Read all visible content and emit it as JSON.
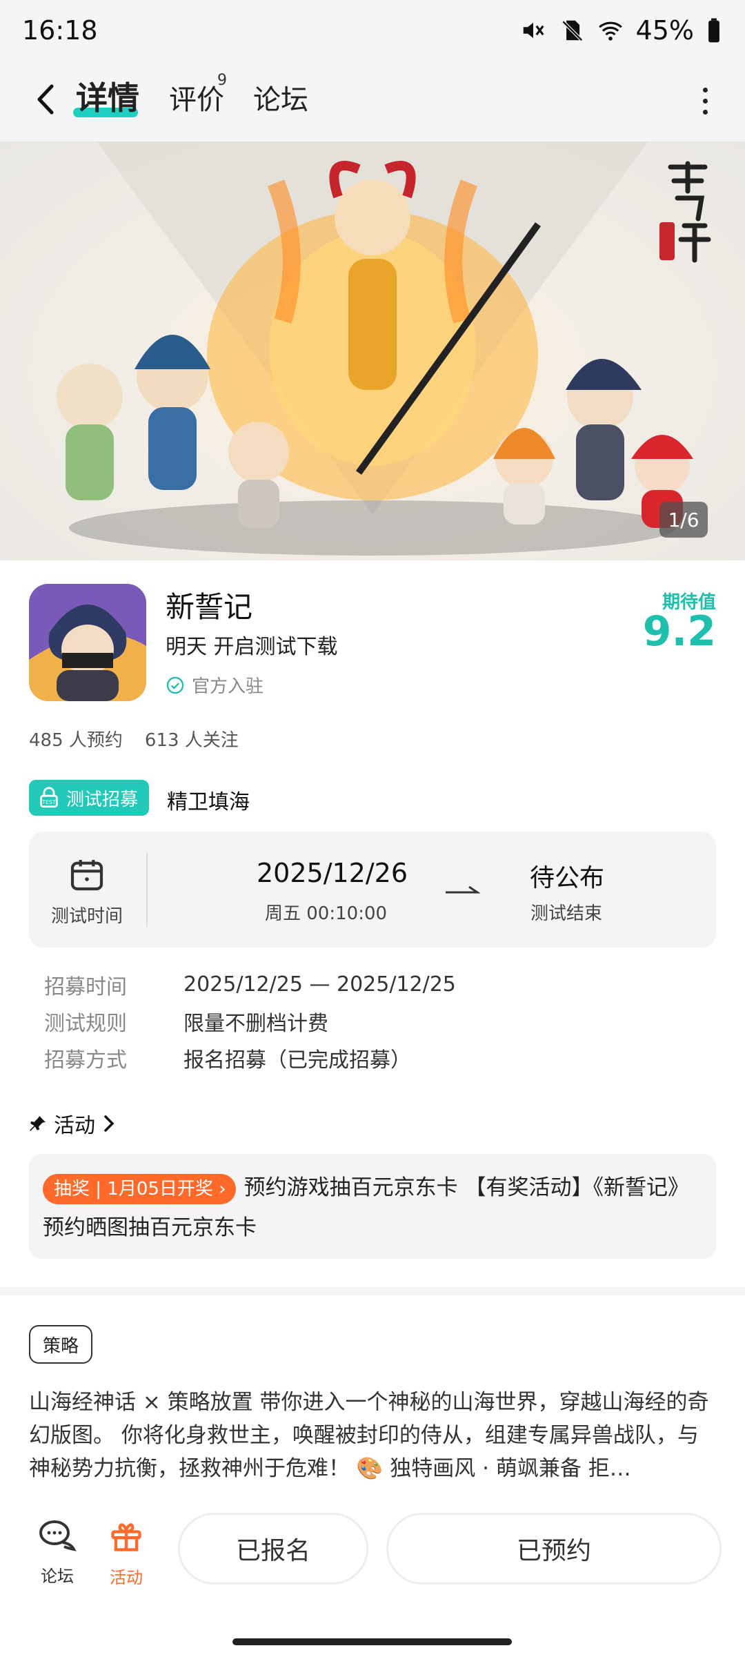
{
  "status_bar": {
    "time": "16:18",
    "battery": "45%"
  },
  "nav": {
    "tabs": [
      {
        "label": "详情"
      },
      {
        "label": "评价"
      },
      {
        "label": "论坛"
      }
    ],
    "review_count": "9"
  },
  "banner": {
    "counter": "1/6",
    "logo_text": "新誓记"
  },
  "game": {
    "title": "新誓记",
    "subtitle": "明天 开启测试下载",
    "official": "官方入驻",
    "expect_label": "期待值",
    "expect_value": "9.2",
    "stats": {
      "reservations": "485 人预约",
      "followers": "613 人关注"
    }
  },
  "recruit": {
    "badge": "测试招募",
    "name": "精卫填海"
  },
  "test_card": {
    "time_label": "测试时间",
    "start_date": "2025/12/26",
    "start_sub": "周五  00:10:00",
    "end_value": "待公布",
    "end_sub": "测试结束"
  },
  "info": [
    {
      "key": "招募时间",
      "value": "2025/12/25 — 2025/12/25"
    },
    {
      "key": "测试规则",
      "value": "限量不删档计费"
    },
    {
      "key": "招募方式",
      "value": "报名招募（已完成招募）"
    }
  ],
  "activity": {
    "heading": "活动",
    "tag": "抽奖 | 1月05日开奖",
    "text": "预约游戏抽百元京东卡 【有奖活动】《新誓记》预约晒图抽百元京东卡"
  },
  "tag_chip": "策略",
  "description": "山海经神话 × 策略放置 带你进入一个神秘的山海世界，穿越山海经的奇幻版图。 你将化身救世主，唤醒被封印的侍从，组建专属异兽战队，与神秘势力抗衡，拯救神州于危难！ 🎨 独特画风 · 萌飒兼备 拒…",
  "bottom_bar": {
    "forum_label": "论坛",
    "activity_label": "活动",
    "registered_button": "已报名",
    "reserved_button": "已预约"
  },
  "colors": {
    "accent": "#1fbfae",
    "orange": "#ff6a2b"
  }
}
